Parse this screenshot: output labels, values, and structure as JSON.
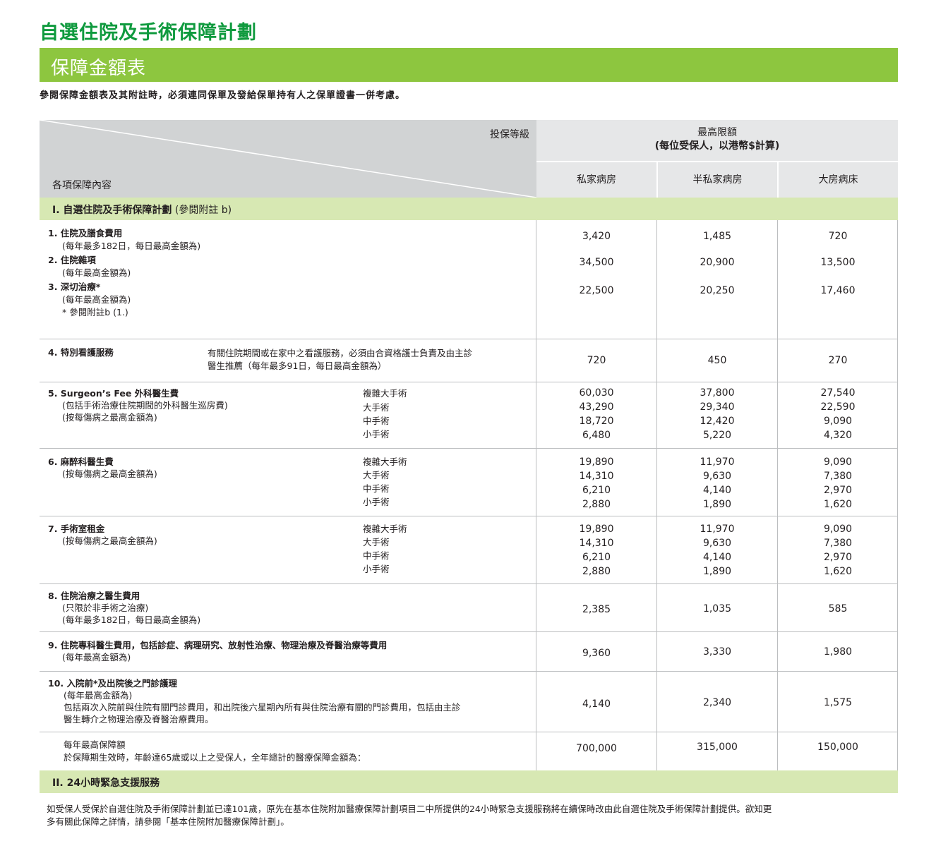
{
  "header": {
    "title": "自選住院及手術保障計劃",
    "banner": "保障金額表",
    "intro": "參閱保障金額表及其附註時，必須連同保單及發給保單持有人之保單證書一併考慮。"
  },
  "table_header": {
    "grade_label": "投保等級",
    "items_label": "各項保障內容",
    "max_line1": "最高限額",
    "max_line2": "(每位受保人，以港幣$計算)",
    "columns": [
      "私家病房",
      "半私家病房",
      "大房病床"
    ]
  },
  "section1": {
    "label": "I. 自選住院及手術保障計劃",
    "note": "(參閱附註 b)"
  },
  "items": {
    "r1": {
      "title": "1. 住院及膳食費用",
      "sub": "(每年最多182日，每日最高金額為)",
      "values": [
        "3,420",
        "1,485",
        "720"
      ]
    },
    "r2": {
      "title": "2. 住院雜項",
      "sub": "(每年最高金額為)",
      "values": [
        "34,500",
        "20,900",
        "13,500"
      ]
    },
    "r3": {
      "title": "3. 深切治療*",
      "sub": "(每年最高金額為)",
      "note": "* 參閱附註b (1.)",
      "values": [
        "22,500",
        "20,250",
        "17,460"
      ]
    },
    "r4": {
      "title": "4. 特別看護服務",
      "desc1": "有關住院期間或在家中之看護服務，必須由合資格護士負責及由主診",
      "desc2": "醫生推薦（每年最多91日，每日最高金額為）",
      "values": [
        "720",
        "450",
        "270"
      ]
    },
    "r5": {
      "title": "5. Surgeon’s Fee 外科醫生費",
      "sub1": "(包括手術治療住院期間的外科醫生巡房費)",
      "sub2": "(按每傷病之最高金額為)",
      "values": [
        [
          "60,030",
          "43,290",
          "18,720",
          "6,480"
        ],
        [
          "37,800",
          "29,340",
          "12,420",
          "5,220"
        ],
        [
          "27,540",
          "22,590",
          "9,090",
          "4,320"
        ]
      ]
    },
    "r6": {
      "title": "6. 麻醉科醫生費",
      "sub1": "(按每傷病之最高金額為)",
      "values": [
        [
          "19,890",
          "14,310",
          "6,210",
          "2,880"
        ],
        [
          "11,970",
          "9,630",
          "4,140",
          "1,890"
        ],
        [
          "9,090",
          "7,380",
          "2,970",
          "1,620"
        ]
      ]
    },
    "r7": {
      "title": "7. 手術室租金",
      "sub1": "(按每傷病之最高金額為)",
      "values": [
        [
          "19,890",
          "14,310",
          "6,210",
          "2,880"
        ],
        [
          "11,970",
          "9,630",
          "4,140",
          "1,890"
        ],
        [
          "9,090",
          "7,380",
          "2,970",
          "1,620"
        ]
      ]
    },
    "r8": {
      "title": "8. 住院治療之醫生費用",
      "sub1": "(只限於非手術之治療)",
      "sub2": "(每年最多182日，每日最高金額為)",
      "values": [
        "2,385",
        "1,035",
        "585"
      ]
    },
    "r9": {
      "title": "9. 住院專科醫生費用，包括診症、病理研究、放射性治療、物理治療及脊醫治療等費用",
      "sub1": "(每年最高金額為)",
      "values": [
        "9,360",
        "3,330",
        "1,980"
      ]
    },
    "r10": {
      "title": "10. 入院前*及出院後之門診護理",
      "sub1": "(每年最高金額為)",
      "sub2": "包括兩次入院前與住院有關門診費用，和出院後六星期內所有與住院治療有關的門診費用，包括由主診",
      "sub3": "醫生轉介之物理治療及脊醫治療費用。",
      "values": [
        "4,140",
        "2,340",
        "1,575"
      ]
    },
    "annual": {
      "line1": "每年最高保障額",
      "line2": "於保障期生效時，年齡達65歲或以上之受保人，全年總計的醫療保障金額為：",
      "values": [
        "700,000",
        "315,000",
        "150,000"
      ]
    }
  },
  "surgery_types": [
    "複雜大手術",
    "大手術",
    "中手術",
    "小手術"
  ],
  "section2": {
    "label": "II. 24小時緊急支援服務"
  },
  "footnote": {
    "line1": "如受保人受保於自選住院及手術保障計劃並已達101歲，原先在基本住院附加醫療保障計劃項目二中所提供的24小時緊急支援服務將在續保時改由此自選住院及手術保障計劃提供。欲知更",
    "line2": "多有關此保障之詳情，請參閱「基本住院附加醫療保障計劃」。"
  },
  "colors": {
    "title_green": "#0f9a3e",
    "banner_green": "#8dc63f",
    "section_green": "#d7e8b3",
    "header_grey": "#d1d3d4"
  }
}
